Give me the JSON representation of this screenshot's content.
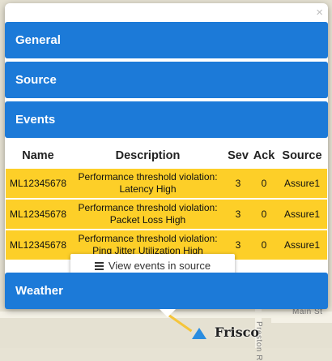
{
  "popup": {
    "close_glyph": "×"
  },
  "sections": {
    "general": "General",
    "source": "Source",
    "events": "Events",
    "weather": "Weather"
  },
  "events_table": {
    "headers": [
      "Name",
      "Description",
      "Sev",
      "Ack",
      "Source"
    ],
    "rows": [
      {
        "name": "ML12345678",
        "description_1": "Performance threshold violation:",
        "description_2": "Latency High",
        "sev": "3",
        "ack": "0",
        "source": "Assure1"
      },
      {
        "name": "ML12345678",
        "description_1": "Performance threshold violation:",
        "description_2": "Packet Loss High",
        "sev": "3",
        "ack": "0",
        "source": "Assure1"
      },
      {
        "name": "ML12345678",
        "description_1": "Performance threshold violation:",
        "description_2": "Ping Jitter Utilization High",
        "sev": "3",
        "ack": "0",
        "source": "Assure1"
      }
    ],
    "row_color": "#fdcf28"
  },
  "view_events_button": {
    "label": "View events in source",
    "icon": "list-icon"
  },
  "map": {
    "city_label": "Frisco",
    "street_main": "Main St",
    "street_preston": "Preston R",
    "marker_color": "#2a8de0"
  },
  "accent_color": "#1c7ad8"
}
